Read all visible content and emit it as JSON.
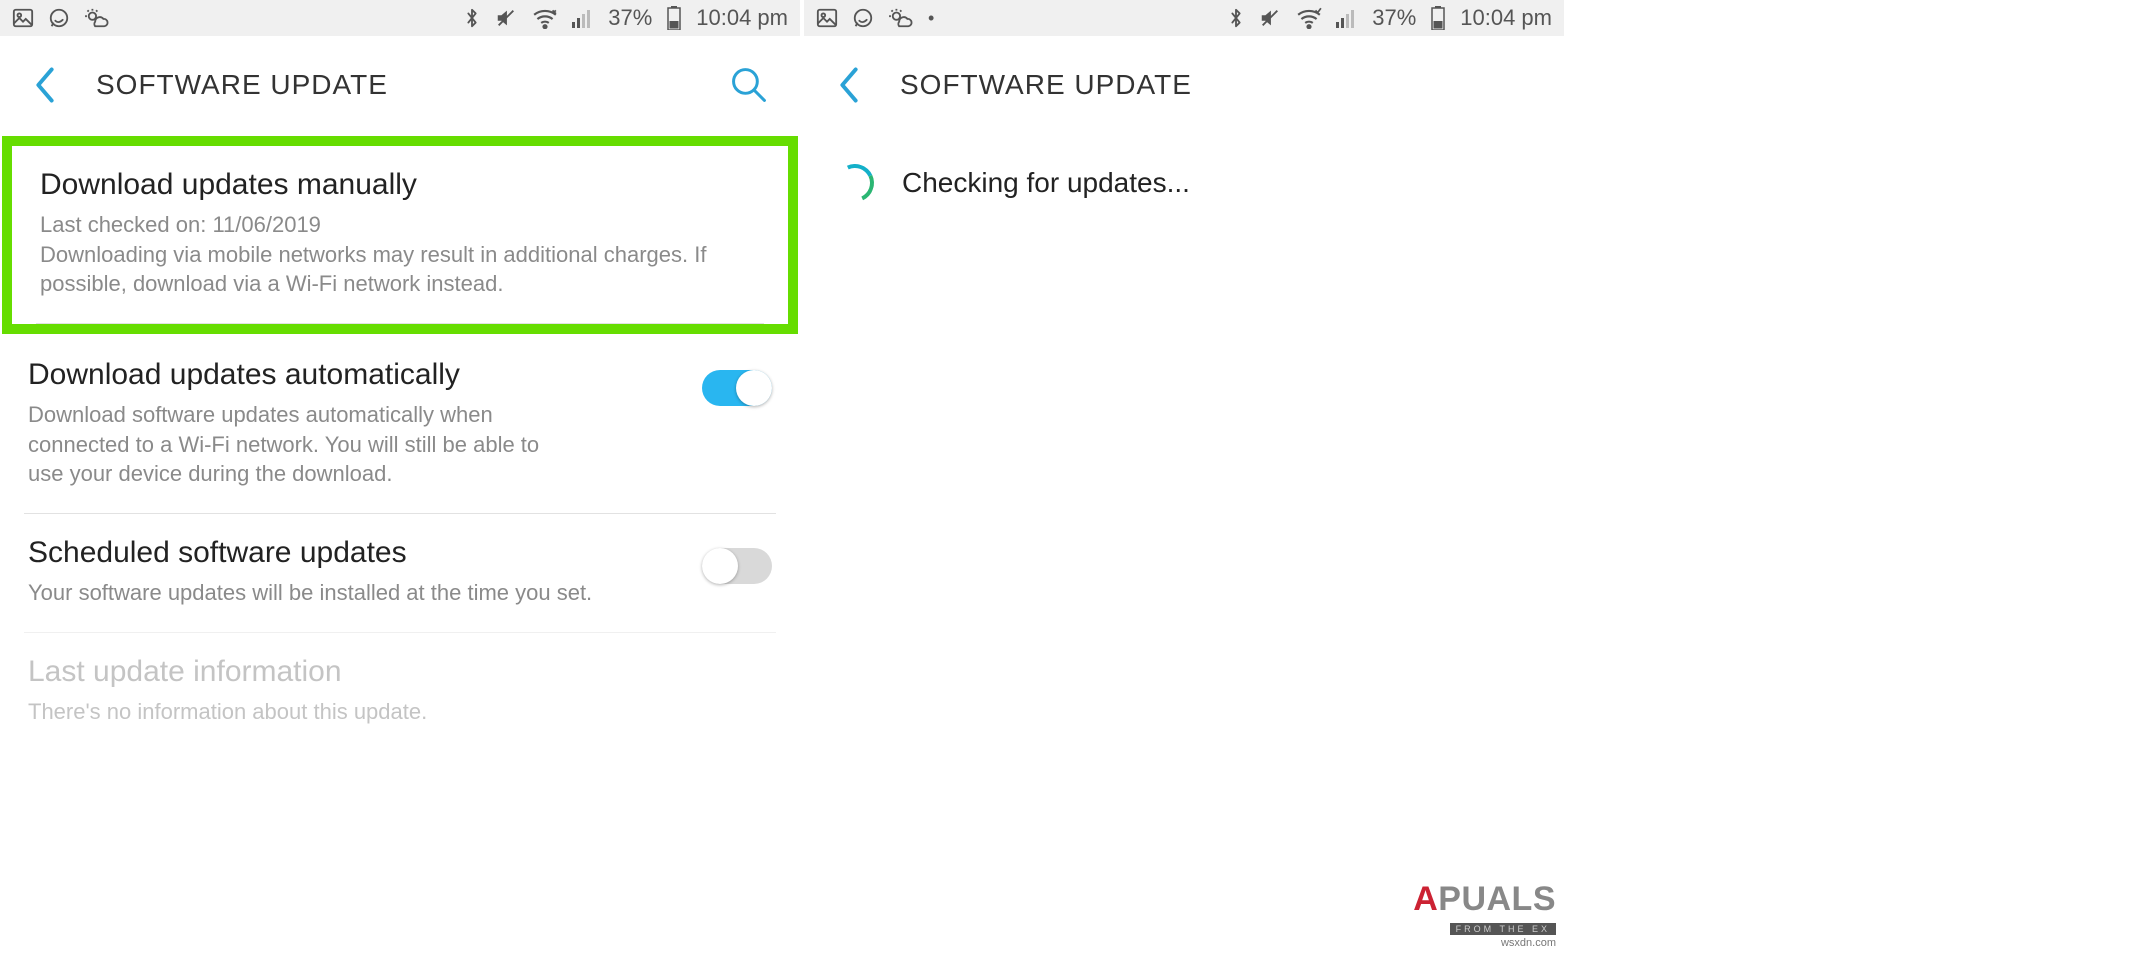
{
  "status_bar": {
    "battery_percent": "37%",
    "time": "10:04 pm"
  },
  "left_screen": {
    "header_title": "SOFTWARE UPDATE",
    "items": {
      "download_manual": {
        "title": "Download updates manually",
        "line1": "Last checked on: 11/06/2019",
        "line2": "Downloading via mobile networks may result in additional charges. If possible, download via a Wi-Fi network instead."
      },
      "download_auto": {
        "title": "Download updates automatically",
        "sub": "Download software updates automatically when connected to a Wi-Fi network. You will still be able to use your device during the download.",
        "toggle_on": true
      },
      "scheduled": {
        "title": "Scheduled software updates",
        "sub": "Your software updates will be installed at the time you set.",
        "toggle_on": false
      },
      "last_info": {
        "title": "Last update information",
        "sub": "There's no information about this update."
      }
    }
  },
  "right_screen": {
    "header_title": "SOFTWARE UPDATE",
    "checking_text": "Checking for updates..."
  },
  "watermark": {
    "brand_part1": "A",
    "brand_part2": "PUALS",
    "strip": "FROM THE EX",
    "site": "wsxdn.com"
  }
}
